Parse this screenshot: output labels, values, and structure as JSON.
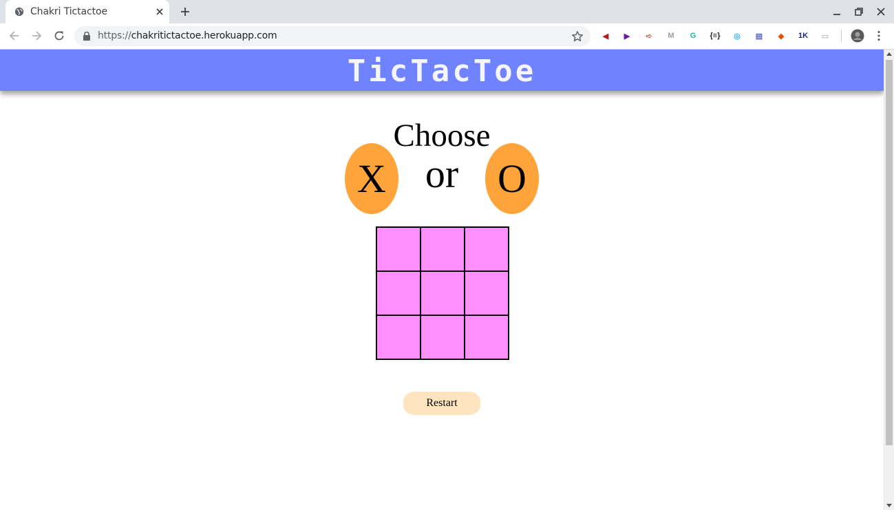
{
  "browser": {
    "tab_title": "Chakri Tictactoe",
    "url_scheme": "https://",
    "url_host": "chakritictactoe.herokuapp.com",
    "extensions": [
      {
        "name": "audio-extension-icon",
        "color": "#b71c1c",
        "glyph": "◀"
      },
      {
        "name": "play-extension-icon",
        "color": "#6a1b9a",
        "glyph": "▶"
      },
      {
        "name": "cast-extension-icon",
        "color": "#ef5350",
        "glyph": "➪"
      },
      {
        "name": "m-extension-icon",
        "color": "#9e9e9e",
        "glyph": "M"
      },
      {
        "name": "grammarly-icon",
        "color": "#15c39a",
        "glyph": "G"
      },
      {
        "name": "json-extension-icon",
        "color": "#202124",
        "glyph": "{≡}"
      },
      {
        "name": "globe-extension-icon",
        "color": "#29b6f6",
        "glyph": "◎"
      },
      {
        "name": "note-extension-icon",
        "color": "#5c6bc0",
        "glyph": "▤"
      },
      {
        "name": "megaphone-extension-icon",
        "color": "#e65100",
        "glyph": "◆"
      },
      {
        "name": "onek-extension-icon",
        "color": "#1a237e",
        "glyph": "1K"
      },
      {
        "name": "blank-extension-icon",
        "color": "#bdbdbd",
        "glyph": "▭"
      }
    ]
  },
  "page": {
    "header_title": "TicTacToe",
    "choose_label": "Choose",
    "option_x": "X",
    "or_label": "or",
    "option_o": "O",
    "restart_label": "Restart",
    "board": [
      "",
      "",
      "",
      "",
      "",
      "",
      "",
      "",
      ""
    ]
  },
  "colors": {
    "header": "#7083ff",
    "option_bg": "#ffa43a",
    "cell_bg": "#ff8ffc",
    "restart_bg": "#ffe5bf"
  }
}
